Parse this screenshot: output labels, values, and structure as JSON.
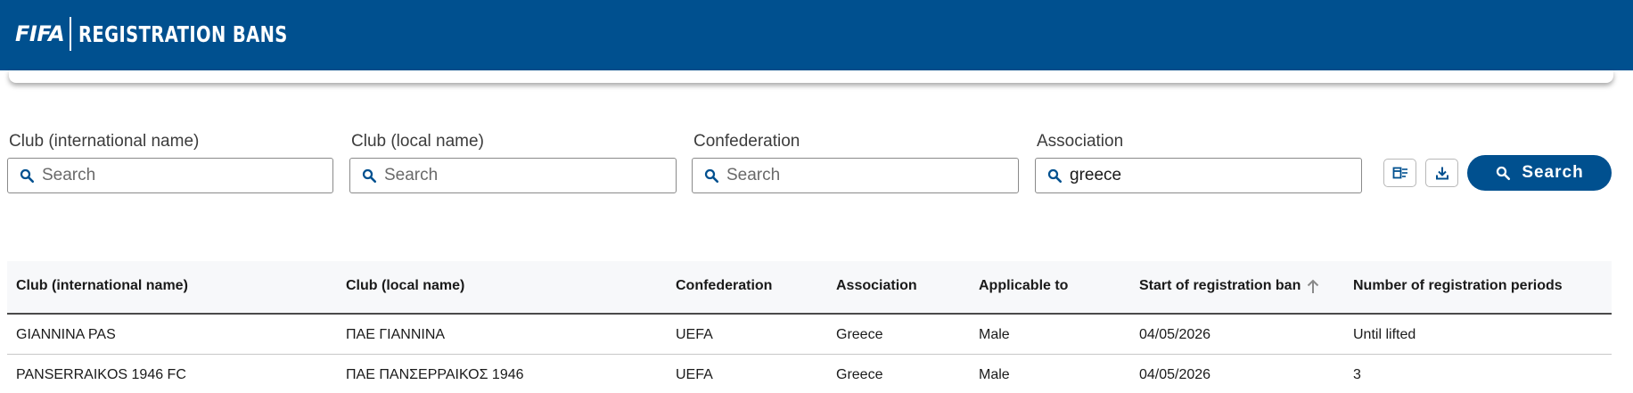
{
  "header": {
    "brand": "FIFA",
    "title": "REGISTRATION BANS",
    "background_color": "#00508f"
  },
  "filters": [
    {
      "label": "Club (international name)",
      "placeholder": "Search",
      "value": ""
    },
    {
      "label": "Club (local name)",
      "placeholder": "Search",
      "value": ""
    },
    {
      "label": "Confederation",
      "placeholder": "Search",
      "value": ""
    },
    {
      "label": "Association",
      "placeholder": "Search",
      "value": "greece"
    }
  ],
  "actions": {
    "clear_filters_icon": "clear-filter-icon",
    "download_icon": "download-icon",
    "search_label": "Search",
    "search_icon": "search-icon"
  },
  "table": {
    "columns": [
      "Club (international name)",
      "Club (local name)",
      "Confederation",
      "Association",
      "Applicable to",
      "Start of registration ban",
      "Number of registration periods"
    ],
    "sorted_column": "Start of registration ban",
    "sort_direction": "ascending",
    "rows": [
      [
        "GIANNINA PAS",
        "ΠΑΕ ΓΙΑΝΝΙΝΑ",
        "UEFA",
        "Greece",
        "Male",
        "04/05/2026",
        "Until lifted"
      ],
      [
        "PANSERRAIKOS 1946 FC",
        "ΠΑΕ ΠΑΝΣΕΡΡΑΙΚΟΣ 1946",
        "UEFA",
        "Greece",
        "Male",
        "04/05/2026",
        "3"
      ]
    ]
  }
}
